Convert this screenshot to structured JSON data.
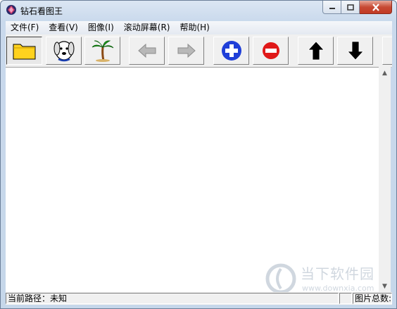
{
  "window": {
    "title": "钻石看图王"
  },
  "menu": [
    {
      "label": "文件(F)"
    },
    {
      "label": "查看(V)"
    },
    {
      "label": "图像(I)"
    },
    {
      "label": "滚动屏幕(R)"
    },
    {
      "label": "帮助(H)"
    }
  ],
  "toolbar": {
    "buttons": [
      "folder-icon",
      "dog-icon",
      "palm-tree-icon",
      "back-arrow-icon",
      "forward-arrow-icon",
      "zoom-in-icon",
      "zoom-out-icon",
      "up-arrow-icon",
      "down-arrow-icon"
    ]
  },
  "status": {
    "path_label": "当前路径：未知",
    "count_label": "图片总数:"
  },
  "watermark": {
    "text": "当下软件园",
    "url": "www.downxia.com"
  },
  "colors": {
    "zoom_blue": "#1f3fd8",
    "zoom_red": "#e01818",
    "folder_yellow": "#ffd21e"
  }
}
